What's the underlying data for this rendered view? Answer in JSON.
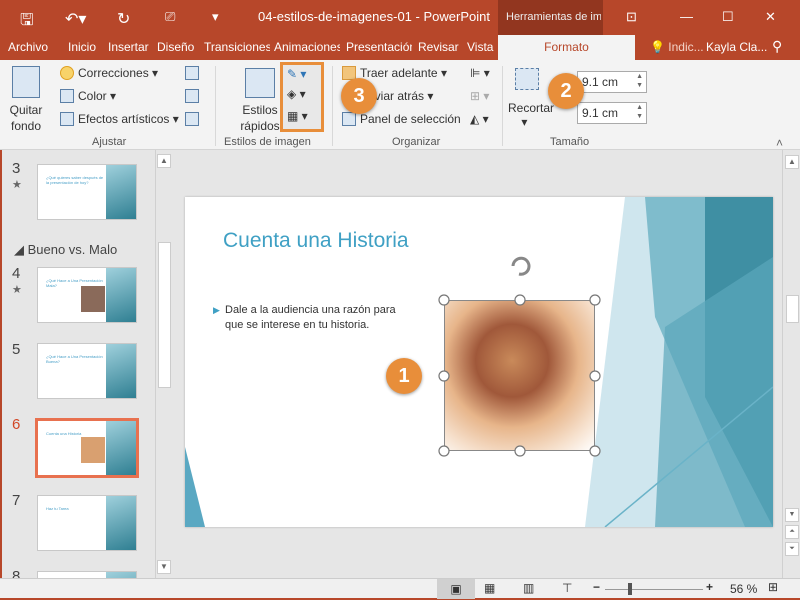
{
  "titlebar": {
    "document_title": "04-estilos-de-imagenes-01 - PowerPoint",
    "context_tools": "Herramientas de imag"
  },
  "tabs": [
    "Archivo",
    "Inicio",
    "Insertar",
    "Diseño",
    "Transiciones",
    "Animaciones",
    "Presentación",
    "Revisar",
    "Vista",
    "Formato"
  ],
  "tell_me": "Indic...",
  "user": "Kayla Cla...",
  "ribbon": {
    "ajustar": {
      "quitar_fondo": "Quitar fondo",
      "correcciones": "Correcciones",
      "color": "Color",
      "efectos": "Efectos artísticos",
      "label": "Ajustar"
    },
    "estilos": {
      "estilos_rapidos": "Estilos rápidos",
      "label": "Estilos de imagen"
    },
    "organizar": {
      "traer": "Traer adelante",
      "enviar": "Enviar atrás",
      "panel": "Panel de selección",
      "label": "Organizar"
    },
    "tamano": {
      "recortar": "Recortar",
      "height": "9.1 cm",
      "width": "9.1 cm",
      "label": "Tamaño"
    }
  },
  "callouts": [
    "1",
    "2",
    "3"
  ],
  "slides_panel": {
    "section": "Bueno vs. Malo",
    "slides": [
      {
        "num": "3",
        "title": "¿Qué quieres saber después de la presentación de hoy?"
      },
      {
        "num": "4",
        "title": "¿Qué Hace a Una Presentación Mala?"
      },
      {
        "num": "5",
        "title": "¿Qué Hace a Una Presentación Buena?"
      },
      {
        "num": "6",
        "title": "Cuenta una Historia"
      },
      {
        "num": "7",
        "title": "Haz tu Tarea"
      },
      {
        "num": "8",
        "title": ""
      }
    ]
  },
  "slide": {
    "title": "Cuenta una Historia",
    "bullet": "Dale a la audiencia una razón para que se interese en tu historia."
  },
  "status": {
    "zoom": "56 %",
    "zoom_level": 56
  },
  "colors": {
    "accent": "#b7472a",
    "callout": "#e88e3a",
    "title": "#3fa0c4"
  }
}
